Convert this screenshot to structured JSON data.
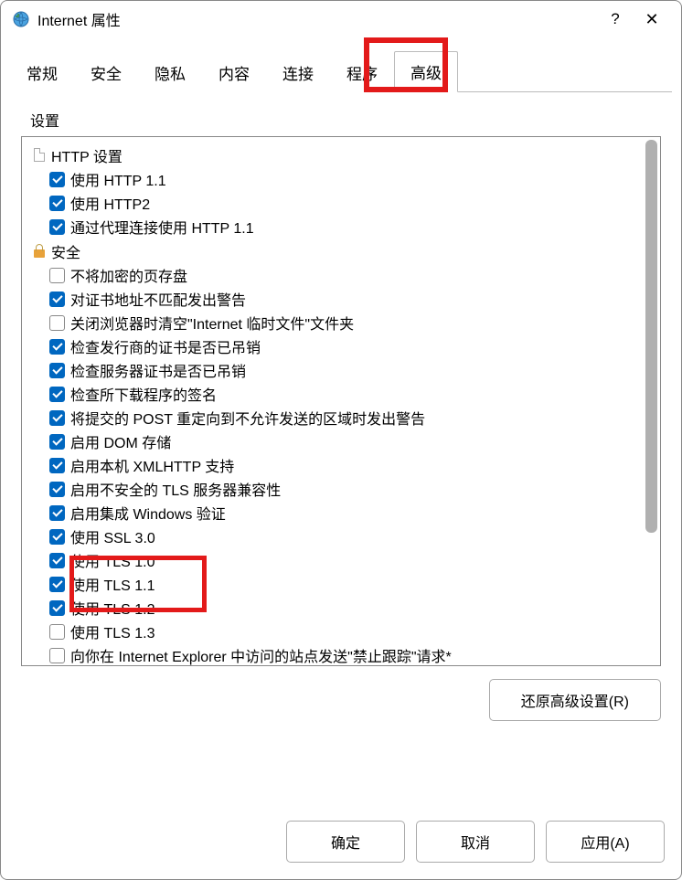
{
  "window": {
    "title": "Internet 属性"
  },
  "tabs": [
    {
      "id": "general",
      "label": "常规",
      "active": false
    },
    {
      "id": "security",
      "label": "安全",
      "active": false
    },
    {
      "id": "privacy",
      "label": "隐私",
      "active": false
    },
    {
      "id": "content",
      "label": "内容",
      "active": false
    },
    {
      "id": "connections",
      "label": "连接",
      "active": false
    },
    {
      "id": "programs",
      "label": "程序",
      "active": false
    },
    {
      "id": "advanced",
      "label": "高级",
      "active": true
    }
  ],
  "settings_label": "设置",
  "groups": [
    {
      "icon": "doc",
      "label": "HTTP 设置",
      "items": [
        {
          "checked": true,
          "label": "使用 HTTP 1.1"
        },
        {
          "checked": true,
          "label": "使用 HTTP2"
        },
        {
          "checked": true,
          "label": "通过代理连接使用 HTTP 1.1"
        }
      ]
    },
    {
      "icon": "lock",
      "label": "安全",
      "items": [
        {
          "checked": false,
          "label": "不将加密的页存盘"
        },
        {
          "checked": true,
          "label": "对证书地址不匹配发出警告"
        },
        {
          "checked": false,
          "label": "关闭浏览器时清空\"Internet 临时文件\"文件夹"
        },
        {
          "checked": true,
          "label": "检查发行商的证书是否已吊销"
        },
        {
          "checked": true,
          "label": "检查服务器证书是否已吊销"
        },
        {
          "checked": true,
          "label": "检查所下载程序的签名"
        },
        {
          "checked": true,
          "label": "将提交的 POST 重定向到不允许发送的区域时发出警告"
        },
        {
          "checked": true,
          "label": "启用 DOM 存储"
        },
        {
          "checked": true,
          "label": "启用本机 XMLHTTP 支持"
        },
        {
          "checked": true,
          "label": "启用不安全的 TLS 服务器兼容性"
        },
        {
          "checked": true,
          "label": "启用集成 Windows 验证"
        },
        {
          "checked": true,
          "label": "使用 SSL 3.0"
        },
        {
          "checked": true,
          "label": "使用 TLS 1.0"
        },
        {
          "checked": true,
          "label": "使用 TLS 1.1"
        },
        {
          "checked": true,
          "label": "使用 TLS 1.2"
        },
        {
          "checked": false,
          "label": "使用 TLS 1.3"
        },
        {
          "checked": false,
          "label": "向你在 Internet Explorer 中访问的站点发送\"禁止跟踪\"请求*"
        }
      ]
    }
  ],
  "buttons": {
    "restore": "还原高级设置(R)",
    "ok": "确定",
    "cancel": "取消",
    "apply": "应用(A)"
  }
}
